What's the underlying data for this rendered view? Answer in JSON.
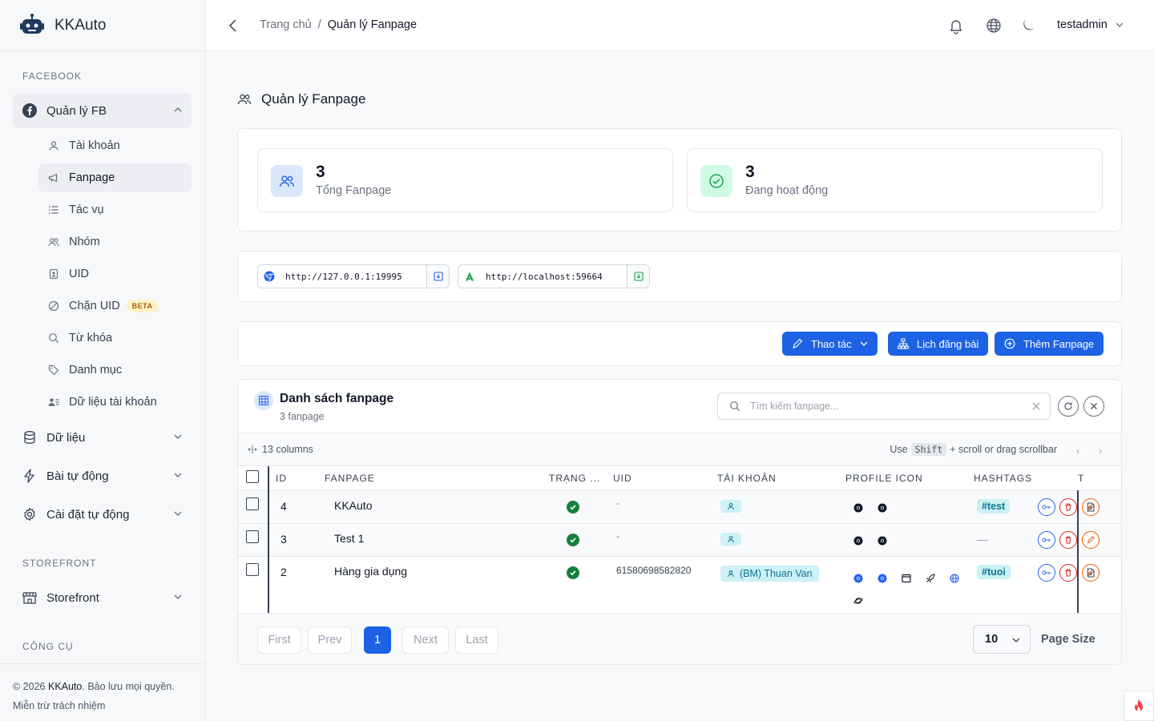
{
  "app": {
    "name": "KKAuto"
  },
  "sidebar": {
    "section_facebook": "FACEBOOK",
    "group_fb": "Quản lý FB",
    "items": [
      {
        "label": "Tài khoản",
        "icon": "user-icon"
      },
      {
        "label": "Fanpage",
        "icon": "megaphone-icon"
      },
      {
        "label": "Tác vụ",
        "icon": "list-icon"
      },
      {
        "label": "Nhóm",
        "icon": "users-icon"
      },
      {
        "label": "UID",
        "icon": "id-badge-icon"
      },
      {
        "label": "Chặn UID",
        "icon": "block-icon",
        "badge": "BETA"
      },
      {
        "label": "Từ khóa",
        "icon": "search-icon"
      },
      {
        "label": "Danh mục",
        "icon": "tag-icon"
      },
      {
        "label": "Dữ liệu tài khoản",
        "icon": "user-data-icon"
      }
    ],
    "groups": [
      {
        "label": "Dữ liệu",
        "icon": "database-icon"
      },
      {
        "label": "Bài tự động",
        "icon": "bolt-icon"
      },
      {
        "label": "Cài đặt tự động",
        "icon": "gear-icon"
      }
    ],
    "section_storefront": "STOREFRONT",
    "storefront": "Storefront",
    "section_tools": "CÔNG CỤ",
    "footer_copyright_prefix": "© 2026",
    "footer_brand": "KKAuto",
    "footer_rights": ". Bảo lưu mọi quyền.",
    "footer_disclaimer": "Miễn trừ trách nhiệm"
  },
  "header": {
    "breadcrumb_home": "Trang chủ",
    "breadcrumb_sep": "/",
    "breadcrumb_current": "Quản lý Fanpage",
    "username": "testadmin"
  },
  "page": {
    "title": "Quản lý Fanpage",
    "stats": [
      {
        "value": "3",
        "label": "Tổng Fanpage"
      },
      {
        "value": "3",
        "label": "Đang hoạt động"
      }
    ],
    "urls": [
      {
        "value": "http://127.0.0.1:19995"
      },
      {
        "value": "http://localhost:59664"
      }
    ],
    "actions": {
      "thao_tac": "Thao tác",
      "lich_dang_bai": "Lịch đăng bài",
      "them_fanpage": "Thêm Fanpage"
    }
  },
  "list": {
    "title": "Danh sách fanpage",
    "subtitle": "3 fanpage",
    "search_placeholder": "Tìm kiếm fanpage...",
    "columns_count": "13 columns",
    "hint_use": "Use",
    "hint_key": "Shift",
    "hint_rest": "+ scroll or drag scrollbar",
    "headers": [
      "ID",
      "FANPAGE",
      "TRẠNG ...",
      "UID",
      "TÀI KHOẢN",
      "PROFILE ICON",
      "HASHTAGS",
      "T"
    ],
    "rows": [
      {
        "id": "4",
        "name": "KKAuto",
        "uid": "-",
        "account": "",
        "hashtag": "#test"
      },
      {
        "id": "3",
        "name": "Test 1",
        "uid": "-",
        "account": "",
        "hashtag": "—"
      },
      {
        "id": "2",
        "name": "Hàng gia dụng",
        "uid": "61580698582820",
        "account": "(BM) Thuan Van",
        "hashtag": "#tuoi"
      }
    ]
  },
  "pagination": {
    "first": "First",
    "prev": "Prev",
    "current": "1",
    "next": "Next",
    "last": "Last",
    "page_size": "10",
    "page_size_label": "Page Size"
  },
  "colors": {
    "primary": "#1d62e5",
    "success": "#15803d",
    "cyan_badge": "#ccf1f6"
  }
}
